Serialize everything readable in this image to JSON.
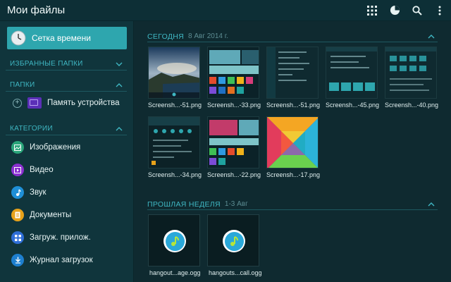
{
  "app": {
    "title": "Мои файлы"
  },
  "toolbar": {
    "icons": [
      "grid-view-icon",
      "storage-usage-icon",
      "search-icon",
      "overflow-menu-icon"
    ]
  },
  "sidebar": {
    "timeline_label": "Сетка времени",
    "favorites_title": "ИЗБРАННЫЕ ПАПКИ",
    "folders_title": "ПАПКИ",
    "device_storage_label": "Память устройства",
    "categories_title": "КАТЕГОРИИ",
    "categories": [
      {
        "label": "Изображения",
        "icon": "images-icon",
        "color": "#2aa57a"
      },
      {
        "label": "Видео",
        "icon": "video-icon",
        "color": "#8a2fcf"
      },
      {
        "label": "Звук",
        "icon": "music-icon",
        "color": "#1f8fd6"
      },
      {
        "label": "Документы",
        "icon": "documents-icon",
        "color": "#e7a21a"
      },
      {
        "label": "Загруж. прилож.",
        "icon": "downloaded-apps-icon",
        "color": "#2f6fd8"
      },
      {
        "label": "Журнал загрузок",
        "icon": "download-history-icon",
        "color": "#1e7fcf"
      }
    ]
  },
  "main": {
    "today": {
      "title": "СЕГОДНЯ",
      "date": "8 Авг 2014 г.",
      "files": [
        "Screensh...-51.png",
        "Screensh...-33.png",
        "Screensh...-51.png",
        "Screensh...-45.png",
        "Screensh...-40.png",
        "Screensh...-34.png",
        "Screensh...-22.png",
        "Screensh...-17.png"
      ]
    },
    "last_week": {
      "title": "ПРОШЛАЯ НЕДЕЛЯ",
      "date": "1-3 Авг",
      "files": [
        "hangout...age.ogg",
        "hangouts...call.ogg"
      ]
    }
  },
  "colors": {
    "accent": "#3fb7c3",
    "selected": "#2ea6ae",
    "background": "#0f2a30"
  }
}
